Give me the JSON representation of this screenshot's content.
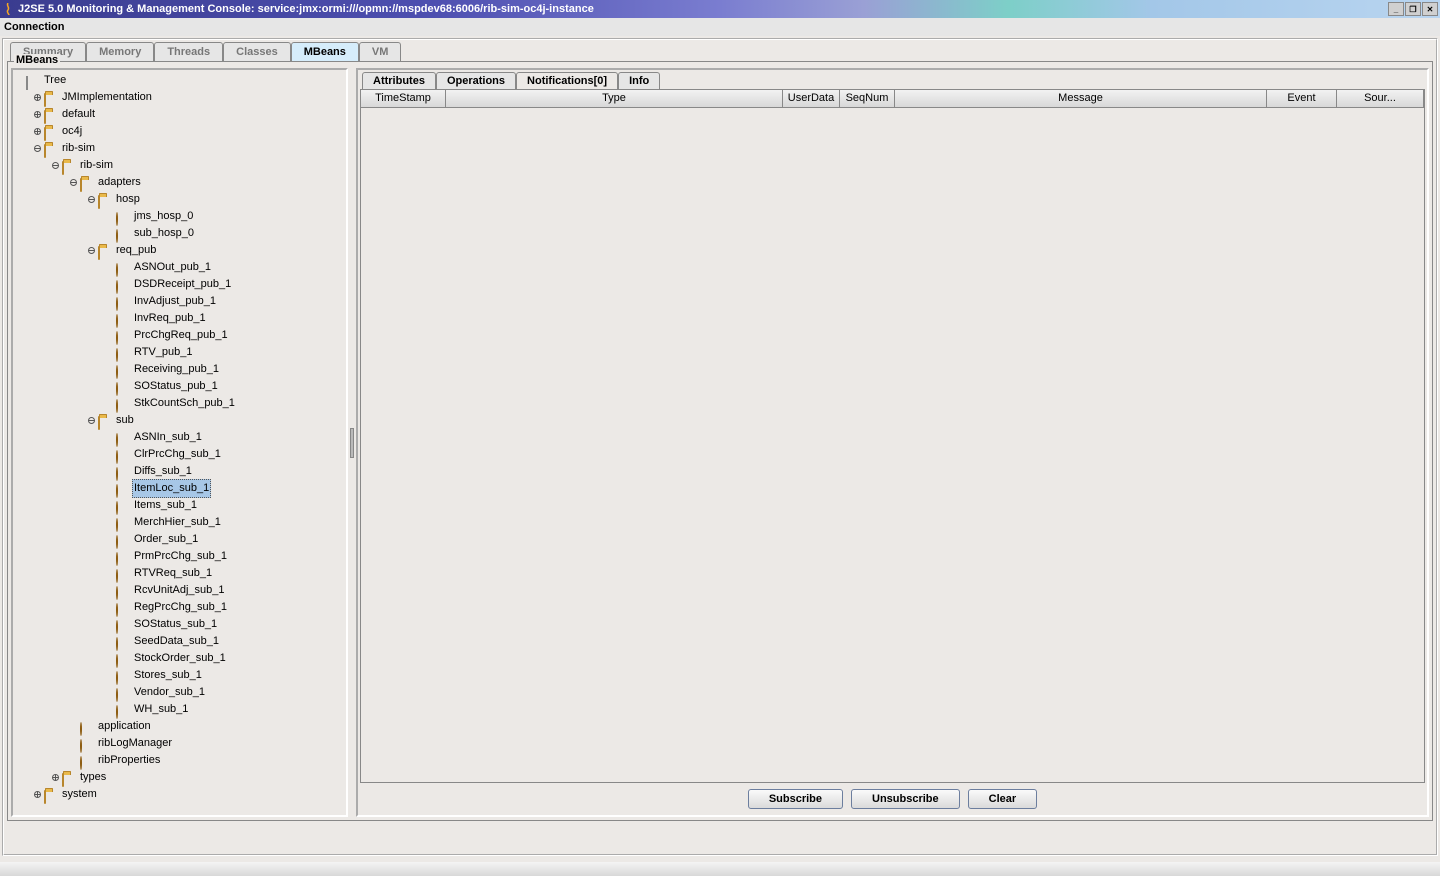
{
  "window": {
    "title": "J2SE 5.0 Monitoring & Management Console: service:jmx:ormi:///opmn://mspdev68:6006/rib-sim-oc4j-instance"
  },
  "menu": {
    "connection": "Connection"
  },
  "tool_tabs": {
    "summary": "Summary",
    "memory": "Memory",
    "threads": "Threads",
    "classes": "Classes",
    "mbeans": "MBeans",
    "vm": "VM"
  },
  "panel_label": "MBeans",
  "tree": {
    "root": "Tree",
    "jmimpl": "JMImplementation",
    "default": "default",
    "oc4j": "oc4j",
    "ribsim": "rib-sim",
    "ribsim2": "rib-sim",
    "adapters": "adapters",
    "hosp": "hosp",
    "hosp_items": [
      "jms_hosp_0",
      "sub_hosp_0"
    ],
    "req_pub": "req_pub",
    "req_pub_items": [
      "ASNOut_pub_1",
      "DSDReceipt_pub_1",
      "InvAdjust_pub_1",
      "InvReq_pub_1",
      "PrcChgReq_pub_1",
      "RTV_pub_1",
      "Receiving_pub_1",
      "SOStatus_pub_1",
      "StkCountSch_pub_1"
    ],
    "sub": "sub",
    "sub_items": [
      "ASNIn_sub_1",
      "ClrPrcChg_sub_1",
      "Diffs_sub_1",
      "ItemLoc_sub_1",
      "Items_sub_1",
      "MerchHier_sub_1",
      "Order_sub_1",
      "PrmPrcChg_sub_1",
      "RTVReq_sub_1",
      "RcvUnitAdj_sub_1",
      "RegPrcChg_sub_1",
      "SOStatus_sub_1",
      "SeedData_sub_1",
      "StockOrder_sub_1",
      "Stores_sub_1",
      "Vendor_sub_1",
      "WH_sub_1"
    ],
    "application": "application",
    "riblog": "ribLogManager",
    "ribprops": "ribProperties",
    "types": "types",
    "system": "system",
    "selected": "ItemLoc_sub_1"
  },
  "right_tabs": {
    "attributes": "Attributes",
    "operations": "Operations",
    "notifications": "Notifications[0]",
    "info": "Info"
  },
  "table_headers": {
    "timestamp": "TimeStamp",
    "type": "Type",
    "userdata": "UserData",
    "seqnum": "SeqNum",
    "message": "Message",
    "event": "Event",
    "source": "Sour..."
  },
  "buttons": {
    "subscribe": "Subscribe",
    "unsubscribe": "Unsubscribe",
    "clear": "Clear"
  }
}
